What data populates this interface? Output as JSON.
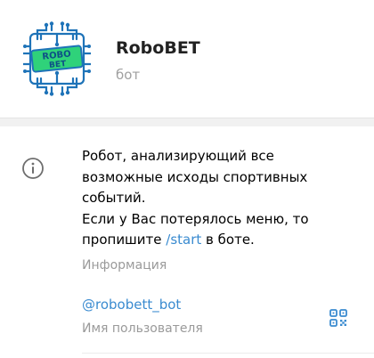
{
  "profile": {
    "name": "RoboBET",
    "subtitle": "бот",
    "avatar_icon": "robobet-logo-icon",
    "avatar_text_top": "ROBO",
    "avatar_text_bottom": "BET"
  },
  "about": {
    "text_before_link": "Робот, анализирующий все\nвозможные исходы спортивных\nсобытий.\nЕсли у Вас потерялось меню, то\nпропишите ",
    "link_text": "/start",
    "text_after_link": " в боте.",
    "caption": "Информация",
    "icon": "info-icon"
  },
  "username": {
    "value": "@robobett_bot",
    "caption": "Имя пользователя",
    "qr_icon": "qr-code-icon"
  },
  "colors": {
    "accent": "#3a8bd0",
    "secondary_text": "#9a9a9a",
    "logo_green": "#2fd27a",
    "logo_blue": "#1e73b8"
  }
}
